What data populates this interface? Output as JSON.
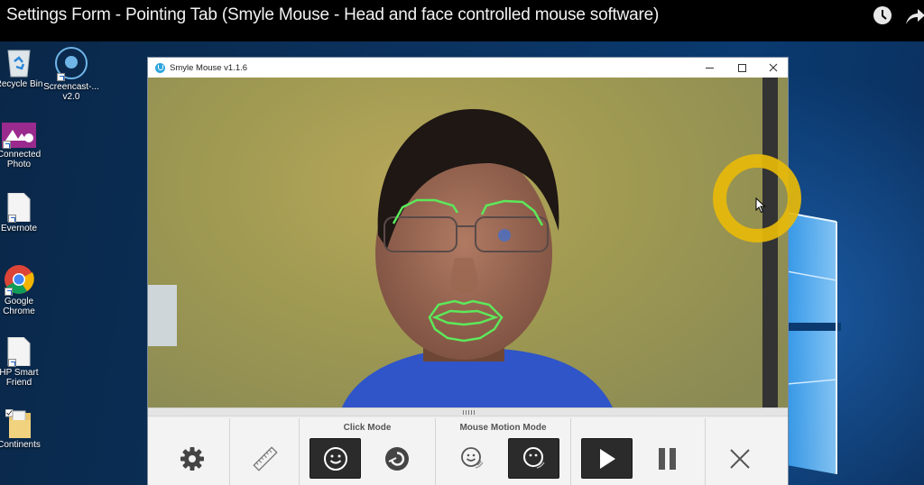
{
  "video": {
    "title": "Settings Form - Pointing Tab (Smyle Mouse - Head and face controlled mouse software)",
    "icons": [
      "clock-icon",
      "share-icon"
    ]
  },
  "desktop": {
    "icons": [
      {
        "label": "Recycle Bin",
        "icon": "recycle-bin-icon"
      },
      {
        "label": "Screencast-...",
        "label2": "v2.0",
        "icon": "screencast-icon"
      },
      {
        "label": "Connected",
        "label2": "Photo",
        "icon": "connected-photo-icon"
      },
      {
        "label": "Evernote",
        "icon": "document-icon"
      },
      {
        "label": "Google",
        "label2": "Chrome",
        "icon": "chrome-icon"
      },
      {
        "label": "HP Smart",
        "label2": "Friend",
        "icon": "document-icon"
      },
      {
        "label": "Continents",
        "icon": "folder-icon"
      }
    ]
  },
  "app": {
    "title": "Smyle Mouse v1.1.6",
    "window_controls": [
      "minimize",
      "maximize",
      "close"
    ],
    "toolbar": {
      "settings_icon": "gear-icon",
      "calibrate_icon": "ruler-icon",
      "click_mode": {
        "label": "Click Mode",
        "options": [
          {
            "name": "smile-click",
            "icon": "smile-icon",
            "active": true
          },
          {
            "name": "dwell-click",
            "icon": "dwell-icon",
            "active": false
          }
        ]
      },
      "mouse_motion_mode": {
        "label": "Mouse Motion Mode",
        "options": [
          {
            "name": "face-motion",
            "icon": "smile-motion-icon",
            "active": false
          },
          {
            "name": "head-motion",
            "icon": "head-motion-icon",
            "active": true
          }
        ]
      },
      "playback": {
        "play_active": true,
        "pause_active": false
      },
      "close_icon": "close-icon"
    }
  },
  "colors": {
    "highlight_ring": "#e6b90a",
    "landmark": "#5de85a",
    "active_button": "#2b2b2b"
  }
}
